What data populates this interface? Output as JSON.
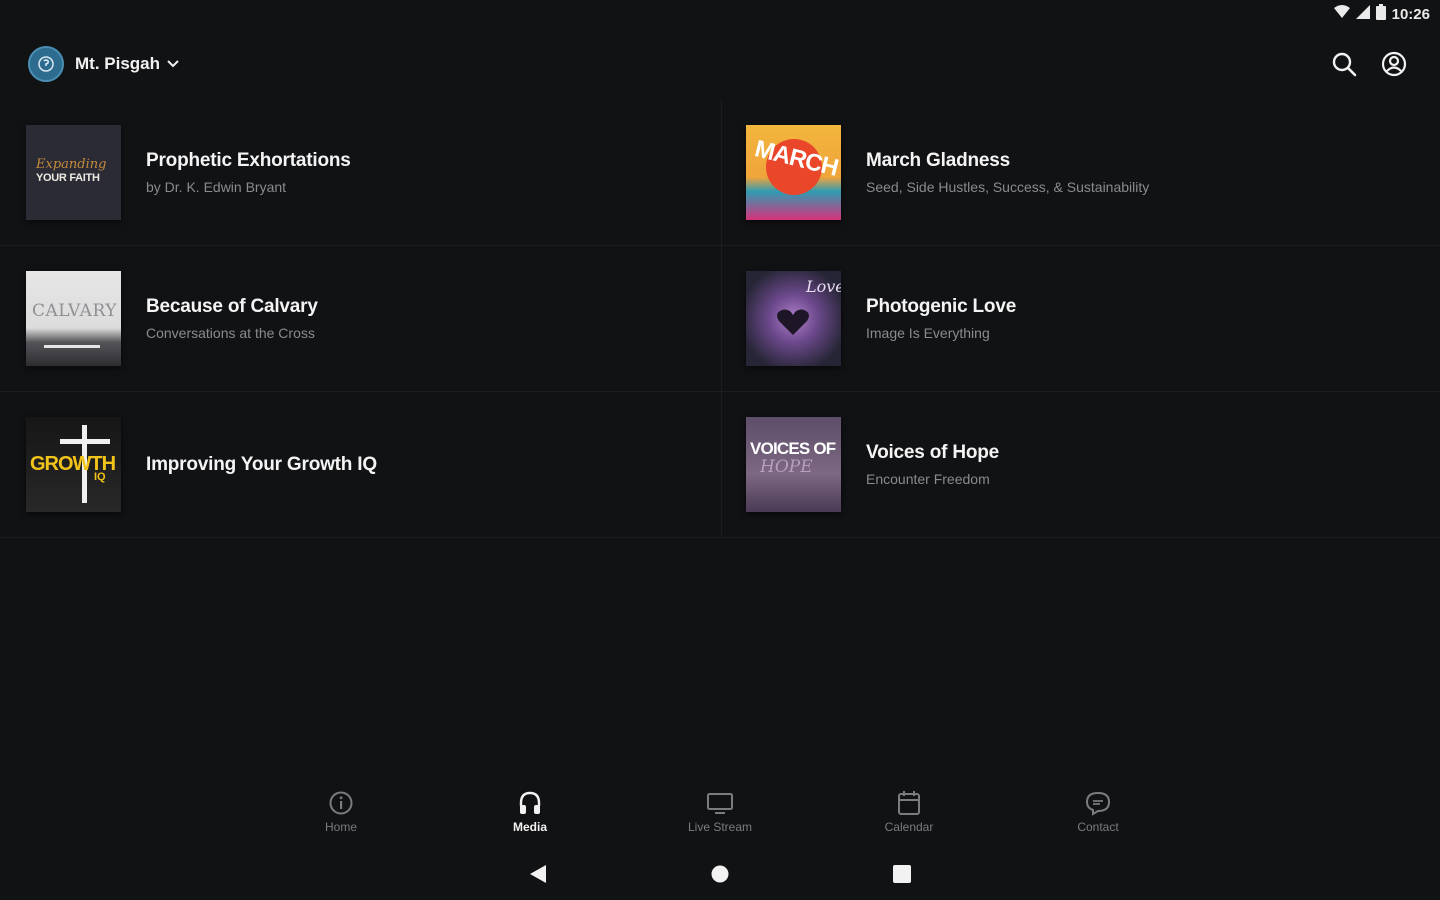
{
  "status_bar": {
    "time": "10:26",
    "icons": [
      "wifi-icon",
      "cell-signal-icon",
      "battery-icon"
    ]
  },
  "header": {
    "org_name": "Mt. Pisgah",
    "actions": [
      "search-icon",
      "account-icon"
    ]
  },
  "media": {
    "items": [
      {
        "title": "Prophetic Exhortations",
        "subtitle": "by Dr. K. Edwin Bryant",
        "thumb_text": [
          "Expanding",
          "YOUR FAITH"
        ]
      },
      {
        "title": "March Gladness",
        "subtitle": "Seed, Side Hustles, Success, & Sustainability",
        "thumb_text": [
          "MARCH"
        ]
      },
      {
        "title": "Because of Calvary",
        "subtitle": "Conversations at the Cross",
        "thumb_text": [
          "CALVARY"
        ]
      },
      {
        "title": "Photogenic Love",
        "subtitle": "Image Is Everything",
        "thumb_text": [
          "Love"
        ]
      },
      {
        "title": "Improving Your Growth IQ",
        "subtitle": "",
        "thumb_text": [
          "GROWTH",
          "IQ"
        ]
      },
      {
        "title": "Voices of Hope",
        "subtitle": "Encounter Freedom",
        "thumb_text": [
          "VOICES OF",
          "HOPE"
        ]
      }
    ]
  },
  "bottom_nav": {
    "items": [
      {
        "label": "Home",
        "icon": "info-circle-icon"
      },
      {
        "label": "Media",
        "icon": "headphones-icon",
        "active": true
      },
      {
        "label": "Live Stream",
        "icon": "tv-icon"
      },
      {
        "label": "Calendar",
        "icon": "calendar-icon"
      },
      {
        "label": "Contact",
        "icon": "chat-icon"
      }
    ]
  },
  "colors": {
    "background": "#111214",
    "text_primary": "#f4f4f4",
    "text_secondary": "#8a8b8f",
    "nav_inactive": "#7b7c80"
  }
}
